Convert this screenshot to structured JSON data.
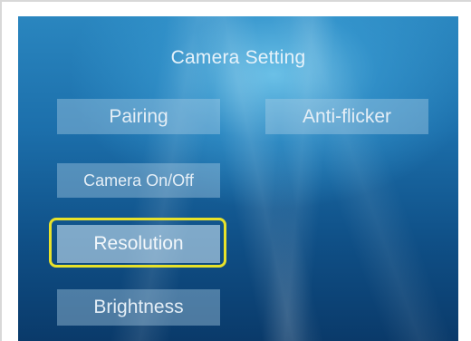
{
  "screen": {
    "title": "Camera Setting"
  },
  "menu": {
    "pairing": "Pairing",
    "anti_flicker": "Anti-flicker",
    "camera_on_off": "Camera On/Off",
    "resolution": "Resolution",
    "brightness": "Brightness",
    "selected_item": "Resolution"
  },
  "colors": {
    "focus_highlight": "#e8e22a",
    "background_top": "#2a86bf",
    "background_bottom": "#0a3a6a"
  }
}
